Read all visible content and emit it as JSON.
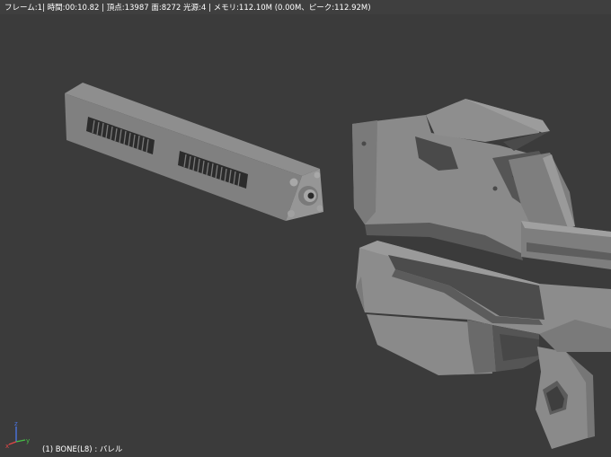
{
  "viewport": {
    "stats_text": "フレーム:1| 時間:00:10.82 | 頂点:13987 面:8272 光源:4 | メモリ:112.10M (0.00M、ピーク:112.92M)",
    "active_object_text": "(1) BONE(L8) : バレル",
    "axis_labels": {
      "x": "x",
      "y": "y",
      "z": "z"
    },
    "colors": {
      "background": "#3b3b3b",
      "mesh_light": "#8a8a8a",
      "mesh_mid": "#6b6b6b",
      "mesh_dark": "#3f3f3f",
      "axis_x": "#e04848",
      "axis_y": "#46c046",
      "axis_z": "#4a74e0"
    }
  }
}
